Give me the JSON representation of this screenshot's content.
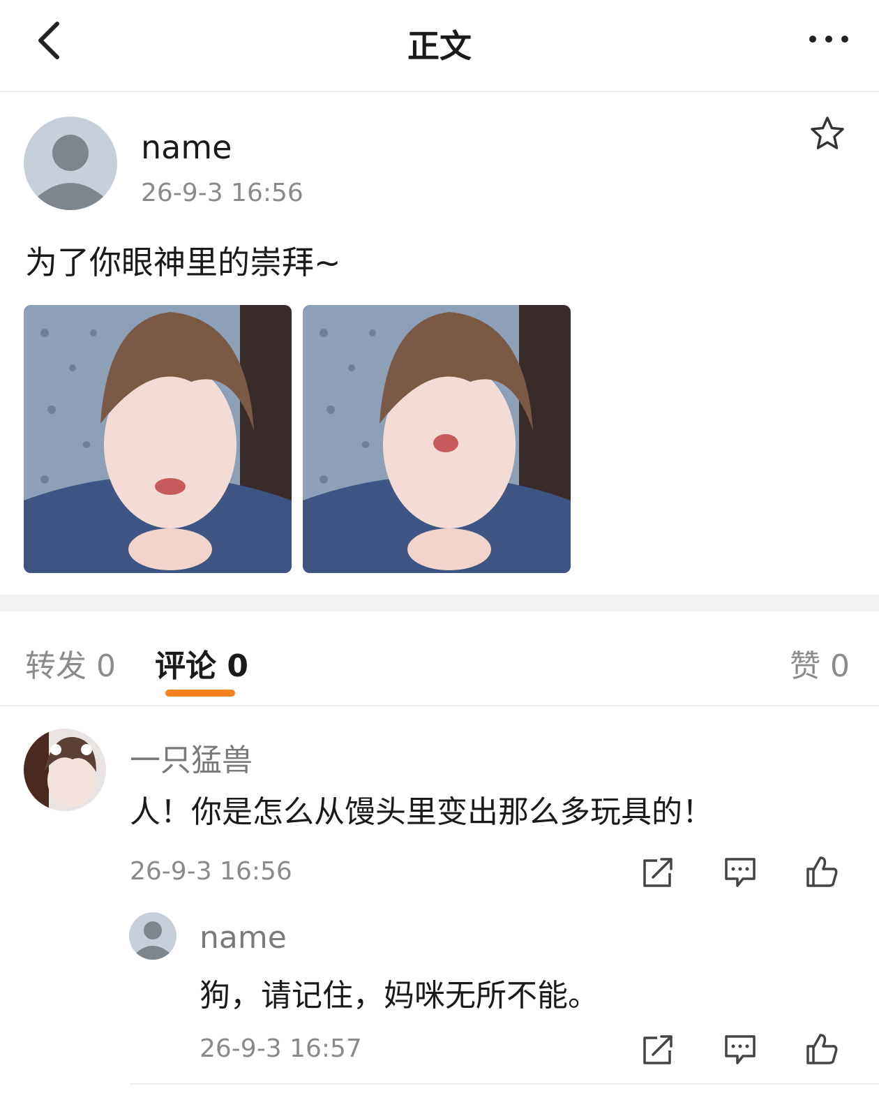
{
  "header": {
    "title": "正文",
    "back_icon": "chevron-left-icon",
    "more_icon": "ellipsis-icon"
  },
  "post": {
    "author": "name",
    "time": "26-9-3 16:56",
    "text": "为了你眼神里的崇拜~",
    "favorite_icon": "star-icon",
    "images": [
      "photo-1",
      "photo-2"
    ]
  },
  "tabs": {
    "repost": "转发 0",
    "comments": "评论 0",
    "likes": "赞 0",
    "active_color": "#f5821f"
  },
  "comment": {
    "user": "一只猛兽",
    "text": "人！你是怎么从馒头里变出那么多玩具的！",
    "time": "26-9-3 16:56"
  },
  "reply": {
    "user": "name",
    "text": "狗，请记住，妈咪无所不能。",
    "time": "26-9-3 16:57"
  }
}
